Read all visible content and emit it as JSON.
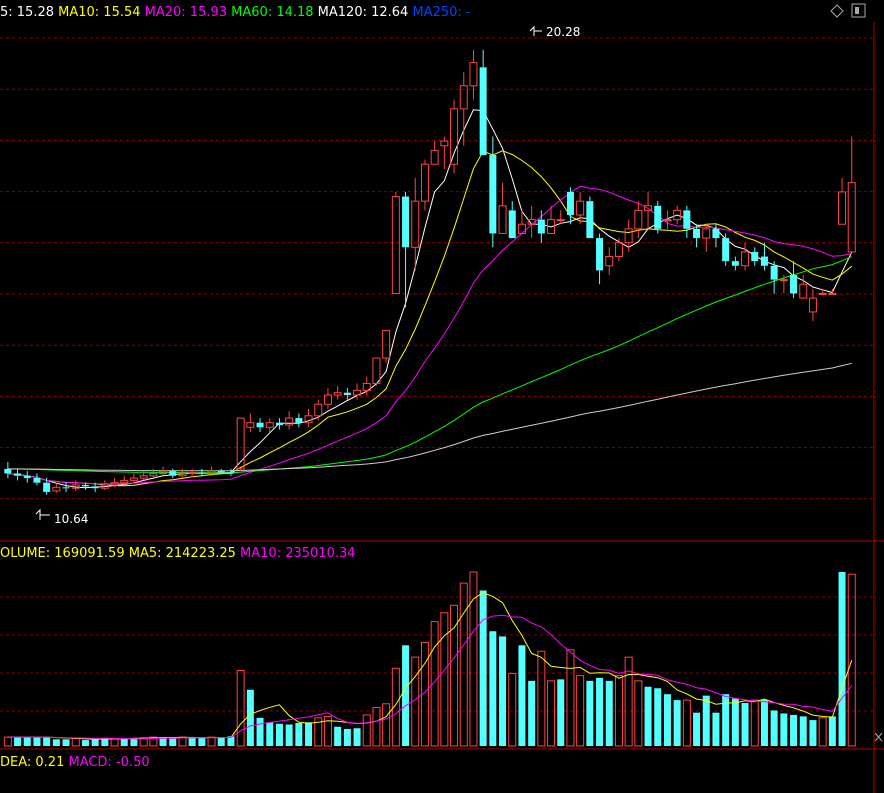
{
  "main_legend": [
    {
      "label": "5: 15.28",
      "color": "#ffffff"
    },
    {
      "label": "MA10: 15.54",
      "color": "#ffff00"
    },
    {
      "label": "MA20: 15.93",
      "color": "#ff00ff"
    },
    {
      "label": "MA60: 14.18",
      "color": "#00ff00"
    },
    {
      "label": "MA120: 12.64",
      "color": "#ffffff"
    },
    {
      "label": "MA250: -",
      "color": "#0044ff"
    }
  ],
  "volume_legend": [
    {
      "label": "OLUME: 169091.59",
      "color": "#ffff00"
    },
    {
      "label": "MA5: 214223.25",
      "color": "#ffff00"
    },
    {
      "label": "MA10: 235010.34",
      "color": "#ff00ff"
    }
  ],
  "macd_legend": [
    {
      "label": "DEA: 0.21",
      "color": "#ffff00"
    },
    {
      "label": "MACD: -0.50",
      "color": "#ff00ff"
    }
  ],
  "high_label": "20.28",
  "low_label": "10.64",
  "colors": {
    "up": "#ff4444",
    "down": "#54ffff",
    "grid": "#8b0000",
    "border": "#b00000",
    "ma5": "#ffffff",
    "ma10": "#ffff00",
    "ma20": "#ff00ff",
    "ma60": "#00ff00",
    "ma120": "#cccccc"
  },
  "chart_data": {
    "type": "candlestick",
    "price_range": [
      10.2,
      20.6
    ],
    "candles": [
      [
        11.2,
        11.1,
        11.35,
        11.0
      ],
      [
        11.1,
        11.05,
        11.2,
        10.95
      ],
      [
        11.05,
        11.0,
        11.15,
        10.9
      ],
      [
        11.0,
        10.9,
        11.1,
        10.85
      ],
      [
        10.9,
        10.7,
        11.0,
        10.64
      ],
      [
        10.72,
        10.8,
        10.9,
        10.68
      ],
      [
        10.8,
        10.78,
        10.92,
        10.7
      ],
      [
        10.78,
        10.85,
        10.95,
        10.72
      ],
      [
        10.85,
        10.82,
        10.9,
        10.75
      ],
      [
        10.82,
        10.78,
        10.9,
        10.7
      ],
      [
        10.78,
        10.85,
        10.95,
        10.74
      ],
      [
        10.85,
        10.9,
        11.0,
        10.8
      ],
      [
        10.9,
        10.95,
        11.05,
        10.85
      ],
      [
        10.95,
        11.0,
        11.1,
        10.9
      ],
      [
        11.0,
        11.05,
        11.15,
        10.95
      ],
      [
        11.05,
        11.1,
        11.2,
        11.0
      ],
      [
        11.1,
        11.15,
        11.25,
        11.05
      ],
      [
        11.15,
        11.05,
        11.2,
        11.0
      ],
      [
        11.05,
        11.1,
        11.2,
        11.0
      ],
      [
        11.1,
        11.12,
        11.2,
        11.02
      ],
      [
        11.12,
        11.1,
        11.2,
        11.05
      ],
      [
        11.1,
        11.15,
        11.25,
        11.05
      ],
      [
        11.15,
        11.12,
        11.2,
        11.08
      ],
      [
        11.12,
        11.1,
        11.2,
        11.05
      ],
      [
        11.2,
        12.3,
        12.3,
        11.15
      ],
      [
        12.1,
        12.2,
        12.4,
        12.0
      ],
      [
        12.2,
        12.1,
        12.3,
        12.0
      ],
      [
        12.1,
        12.2,
        12.3,
        12.0
      ],
      [
        12.2,
        12.15,
        12.3,
        12.05
      ],
      [
        12.15,
        12.3,
        12.45,
        12.05
      ],
      [
        12.3,
        12.2,
        12.4,
        12.1
      ],
      [
        12.2,
        12.35,
        12.5,
        12.1
      ],
      [
        12.35,
        12.6,
        12.7,
        12.25
      ],
      [
        12.6,
        12.8,
        12.95,
        12.5
      ],
      [
        12.8,
        12.85,
        13.0,
        12.7
      ],
      [
        12.85,
        12.8,
        12.95,
        12.7
      ],
      [
        12.8,
        12.9,
        13.05,
        12.7
      ],
      [
        12.9,
        13.05,
        13.2,
        12.8
      ],
      [
        13.05,
        13.6,
        13.6,
        13.0
      ],
      [
        13.6,
        14.2,
        14.2,
        13.5
      ],
      [
        15.0,
        17.1,
        17.2,
        15.0
      ],
      [
        17.1,
        16.0,
        17.2,
        14.7
      ],
      [
        16.0,
        17.0,
        17.5,
        15.5
      ],
      [
        17.0,
        17.8,
        17.9,
        16.8
      ],
      [
        17.8,
        18.1,
        18.3,
        17.8
      ],
      [
        18.2,
        18.3,
        18.4,
        17.7
      ],
      [
        17.8,
        19.0,
        19.2,
        17.6
      ],
      [
        19.0,
        19.5,
        19.8,
        18.2
      ],
      [
        19.5,
        20.0,
        20.28,
        19.2
      ],
      [
        19.9,
        18.0,
        20.28,
        18.0
      ],
      [
        18.0,
        16.3,
        18.4,
        16.0
      ],
      [
        16.3,
        16.9,
        17.4,
        16.3
      ],
      [
        16.8,
        16.2,
        17.0,
        16.2
      ],
      [
        16.3,
        16.5,
        16.8,
        16.3
      ],
      [
        16.5,
        16.6,
        16.9,
        16.2
      ],
      [
        16.6,
        16.3,
        16.8,
        16.1
      ],
      [
        16.3,
        16.6,
        16.9,
        16.3
      ],
      [
        16.6,
        16.6,
        16.8,
        16.5
      ],
      [
        17.2,
        16.7,
        17.3,
        16.5
      ],
      [
        16.7,
        17.0,
        17.2,
        16.5
      ],
      [
        17.0,
        16.2,
        17.1,
        16.2
      ],
      [
        16.2,
        15.5,
        16.3,
        15.2
      ],
      [
        15.6,
        15.8,
        16.0,
        15.4
      ],
      [
        15.8,
        16.1,
        16.2,
        15.7
      ],
      [
        16.1,
        16.4,
        16.6,
        15.9
      ],
      [
        16.4,
        16.8,
        17.0,
        16.2
      ],
      [
        16.8,
        16.9,
        17.2,
        16.4
      ],
      [
        16.9,
        16.4,
        17.0,
        16.3
      ],
      [
        16.6,
        16.6,
        16.8,
        16.4
      ],
      [
        16.6,
        16.8,
        16.9,
        16.5
      ],
      [
        16.8,
        16.4,
        16.9,
        16.2
      ],
      [
        16.4,
        16.2,
        16.5,
        16.0
      ],
      [
        16.2,
        16.4,
        16.5,
        15.9
      ],
      [
        16.4,
        16.2,
        16.5,
        16.0
      ],
      [
        16.2,
        15.7,
        16.3,
        15.6
      ],
      [
        15.7,
        15.6,
        15.8,
        15.5
      ],
      [
        15.6,
        15.9,
        16.1,
        15.5
      ],
      [
        15.9,
        15.7,
        16.0,
        15.6
      ],
      [
        15.8,
        15.6,
        16.1,
        15.5
      ],
      [
        15.6,
        15.3,
        15.7,
        15.0
      ],
      [
        15.3,
        15.3,
        15.4,
        15.0
      ],
      [
        15.4,
        15.0,
        15.7,
        14.9
      ],
      [
        14.9,
        15.2,
        15.4,
        14.9
      ],
      [
        14.6,
        14.9,
        15.1,
        14.4
      ],
      [
        15.0,
        15.0,
        15.1,
        15.0
      ],
      [
        15.0,
        15.0,
        15.1,
        15.0
      ],
      [
        16.5,
        17.2,
        17.5,
        16.5
      ],
      [
        15.9,
        17.4,
        18.4,
        15.9
      ]
    ],
    "volume_range": [
      0,
      235000
    ],
    "volumes": [
      [
        12000,
        0
      ],
      [
        12000,
        1
      ],
      [
        12000,
        1
      ],
      [
        12000,
        1
      ],
      [
        12000,
        1
      ],
      [
        9000,
        1
      ],
      [
        9000,
        1
      ],
      [
        10000,
        0
      ],
      [
        8000,
        1
      ],
      [
        9000,
        1
      ],
      [
        11000,
        1
      ],
      [
        10000,
        0
      ],
      [
        10000,
        1
      ],
      [
        11000,
        1
      ],
      [
        11000,
        0
      ],
      [
        12000,
        0
      ],
      [
        12000,
        1
      ],
      [
        11000,
        1
      ],
      [
        12000,
        0
      ],
      [
        11000,
        1
      ],
      [
        11000,
        1
      ],
      [
        12000,
        0
      ],
      [
        11000,
        1
      ],
      [
        13000,
        1
      ],
      [
        102000,
        0
      ],
      [
        76000,
        1
      ],
      [
        38000,
        1
      ],
      [
        32000,
        1
      ],
      [
        30000,
        1
      ],
      [
        29000,
        1
      ],
      [
        31000,
        1
      ],
      [
        32000,
        1
      ],
      [
        38000,
        0
      ],
      [
        40000,
        0
      ],
      [
        26000,
        1
      ],
      [
        23000,
        1
      ],
      [
        24000,
        1
      ],
      [
        42000,
        0
      ],
      [
        52000,
        0
      ],
      [
        57000,
        0
      ],
      [
        105000,
        0
      ],
      [
        136000,
        1
      ],
      [
        120000,
        0
      ],
      [
        140000,
        0
      ],
      [
        168000,
        0
      ],
      [
        180000,
        0
      ],
      [
        190000,
        0
      ],
      [
        220000,
        0
      ],
      [
        235000,
        0
      ],
      [
        210000,
        1
      ],
      [
        155000,
        1
      ],
      [
        148000,
        1
      ],
      [
        98000,
        0
      ],
      [
        136000,
        1
      ],
      [
        88000,
        1
      ],
      [
        128000,
        0
      ],
      [
        88000,
        0
      ],
      [
        90000,
        1
      ],
      [
        130000,
        0
      ],
      [
        95000,
        0
      ],
      [
        88000,
        1
      ],
      [
        92000,
        1
      ],
      [
        88000,
        1
      ],
      [
        95000,
        0
      ],
      [
        120000,
        0
      ],
      [
        88000,
        0
      ],
      [
        80000,
        1
      ],
      [
        78000,
        1
      ],
      [
        70000,
        1
      ],
      [
        62000,
        1
      ],
      [
        62000,
        0
      ],
      [
        45000,
        1
      ],
      [
        68000,
        1
      ],
      [
        45000,
        1
      ],
      [
        70000,
        1
      ],
      [
        64000,
        1
      ],
      [
        58000,
        1
      ],
      [
        62000,
        0
      ],
      [
        62000,
        1
      ],
      [
        48000,
        1
      ],
      [
        44000,
        1
      ],
      [
        42000,
        1
      ],
      [
        40000,
        1
      ],
      [
        35000,
        1
      ],
      [
        38000,
        0
      ],
      [
        40000,
        1
      ],
      [
        235000,
        1
      ],
      [
        232000,
        0
      ]
    ]
  }
}
